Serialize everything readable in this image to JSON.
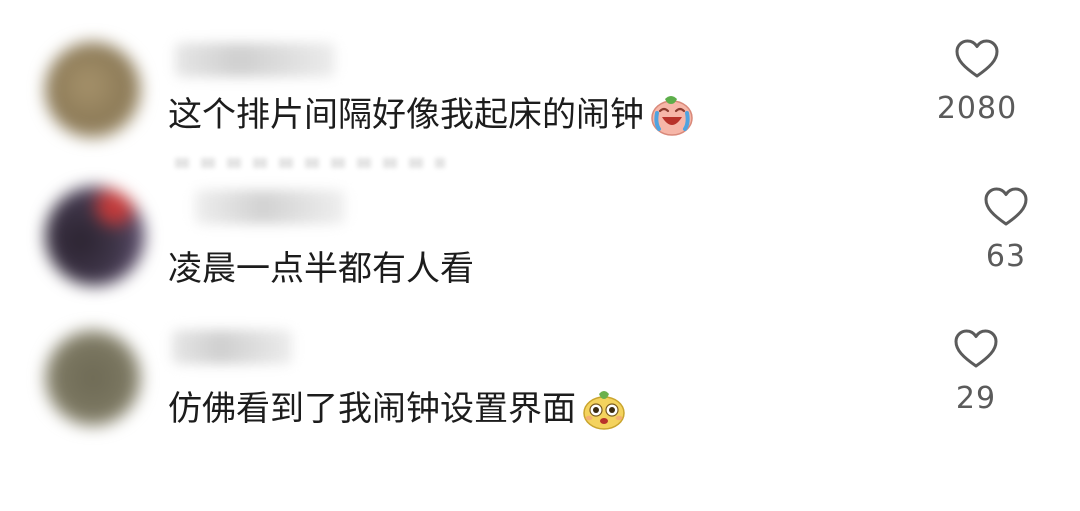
{
  "comments": [
    {
      "text": "这个排片间隔好像我起床的闹钟",
      "emoji": "crying-laugh-emoji",
      "likes": "2080"
    },
    {
      "text": "凌晨一点半都有人看",
      "emoji": "",
      "likes": "63"
    },
    {
      "text": "仿佛看到了我闹钟设置界面",
      "emoji": "surprised-face-emoji",
      "likes": "29"
    }
  ],
  "icons": {
    "like": "heart-outline-icon"
  },
  "colors": {
    "text": "#1c1c1c",
    "count": "#5b5b5b",
    "icon": "#5b5b5b"
  }
}
